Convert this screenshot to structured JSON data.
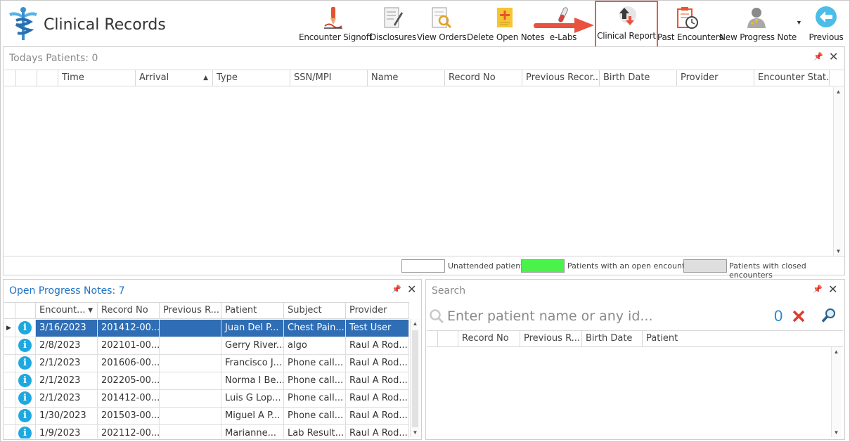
{
  "app": {
    "title": "Clinical Records"
  },
  "toolbar": {
    "items": [
      {
        "label": "Encounter Signoff"
      },
      {
        "label": "Disclosures"
      },
      {
        "label": "View Orders"
      },
      {
        "label": "Delete Open Notes"
      },
      {
        "label": "e-Labs"
      },
      {
        "label": "Clinical Report"
      },
      {
        "label": "Past Encounters"
      },
      {
        "label": "New Progress Note"
      },
      {
        "label": "Previous"
      }
    ]
  },
  "todays": {
    "title": "Todays Patients:",
    "count": "0",
    "columns": [
      "Time",
      "Arrival",
      "Type",
      "SSN/MPI",
      "Name",
      "Record No",
      "Previous Recor...",
      "Birth Date",
      "Provider",
      "Encounter Stat..."
    ]
  },
  "legend": {
    "unattended": "Unattended patients",
    "open": "Patients with an open encounter",
    "closed": "Patients with closed encounters",
    "open_color": "#4cf24c",
    "closed_color": "#dedede"
  },
  "notes": {
    "title": "Open Progress Notes:",
    "count": "7",
    "columns": [
      "Encount...",
      "Record No",
      "Previous R...",
      "Patient",
      "Subject",
      "Provider"
    ],
    "rows": [
      {
        "date": "3/16/2023",
        "record": "201412-00...",
        "prev": "",
        "patient": "Juan Del P...",
        "subject": "Chest Pain....",
        "provider": "Test User"
      },
      {
        "date": "2/8/2023",
        "record": "202101-00...",
        "prev": "",
        "patient": "Gerry River...",
        "subject": "algo",
        "provider": "Raul A Rod..."
      },
      {
        "date": "2/1/2023",
        "record": "201606-00...",
        "prev": "",
        "patient": "Francisco J...",
        "subject": "Phone call...",
        "provider": "Raul A Rod..."
      },
      {
        "date": "2/1/2023",
        "record": "202205-00...",
        "prev": "",
        "patient": "Norma I Be...",
        "subject": "Phone call...",
        "provider": "Raul A Rod..."
      },
      {
        "date": "2/1/2023",
        "record": "201412-00...",
        "prev": "",
        "patient": "Luis G Lop...",
        "subject": "Phone call...",
        "provider": "Raul A Rod..."
      },
      {
        "date": "1/30/2023",
        "record": "201503-00...",
        "prev": "",
        "patient": "Miguel A P...",
        "subject": "Phone call...",
        "provider": "Raul A Rod..."
      },
      {
        "date": "1/9/2023",
        "record": "202112-00...",
        "prev": "",
        "patient": "Marianne...",
        "subject": "Lab Result...",
        "provider": "Raul A Rod..."
      }
    ]
  },
  "search": {
    "title": "Search",
    "placeholder": "Enter patient name or any id...",
    "count": "0",
    "columns": [
      "Record No",
      "Previous R...",
      "Birth Date",
      "Patient"
    ]
  }
}
